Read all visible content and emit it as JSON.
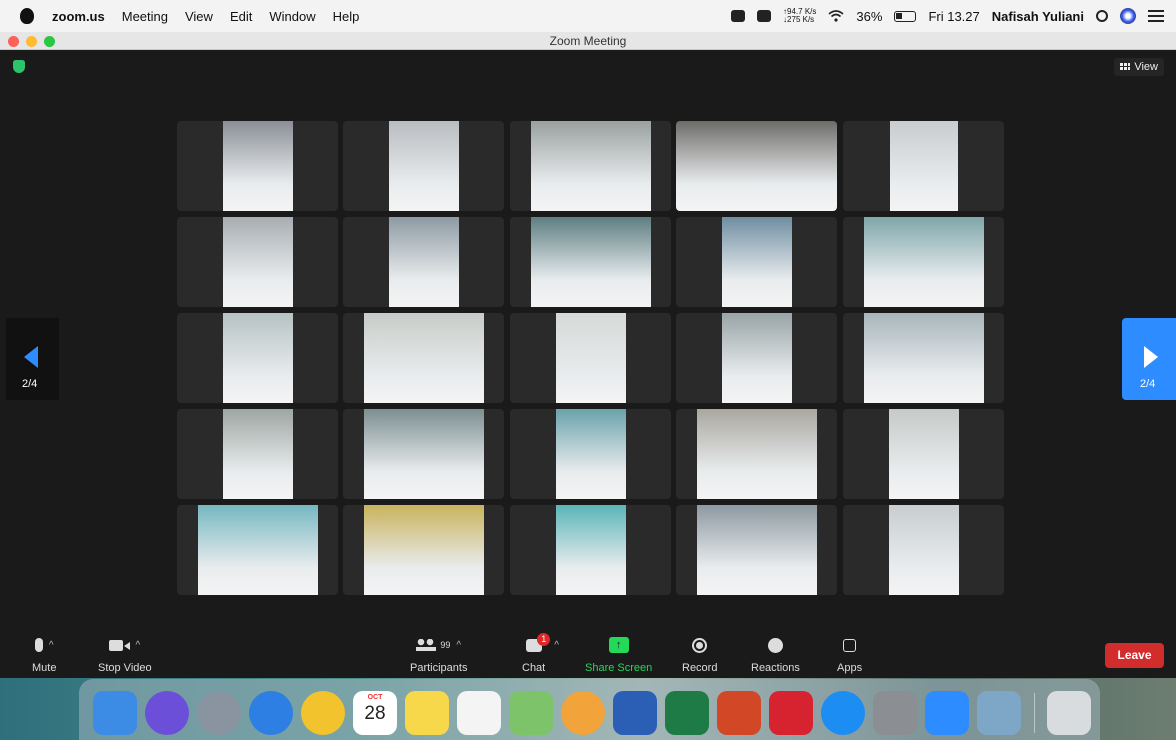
{
  "menubar": {
    "app": "zoom.us",
    "items": [
      "Meeting",
      "View",
      "Edit",
      "Window",
      "Help"
    ],
    "net_up": "↑94.7 K/s",
    "net_down": "↓275 K/s",
    "battery": "36%",
    "clock": "Fri 13.27",
    "user": "Nafisah Yuliani"
  },
  "window": {
    "title": "Zoom Meeting"
  },
  "meeting": {
    "view_label": "View",
    "prev_page": "2/4",
    "next_page": "2/4",
    "tiles": [
      {
        "bg": "#8a8f96"
      },
      {
        "bg": "#b9bcc0"
      },
      {
        "bg": "#9aa0a0"
      },
      {
        "bg": "#6e6c69"
      },
      {
        "bg": "#c9cccf"
      },
      {
        "bg": "#a8adb3"
      },
      {
        "bg": "#8d9aa3"
      },
      {
        "bg": "#5d7e82"
      },
      {
        "bg": "#6f8ea2"
      },
      {
        "bg": "#7fa7aa"
      },
      {
        "bg": "#b6c2c4"
      },
      {
        "bg": "#c8ccc8"
      },
      {
        "bg": "#d5d9d7"
      },
      {
        "bg": "#98a4a6"
      },
      {
        "bg": "#a8b6bb"
      },
      {
        "bg": "#9ea6a2"
      },
      {
        "bg": "#7d8f91"
      },
      {
        "bg": "#6aa3ab"
      },
      {
        "bg": "#a9a7a0"
      },
      {
        "bg": "#c5cac7"
      },
      {
        "bg": "#76b7c1"
      },
      {
        "bg": "#c9b35c"
      },
      {
        "bg": "#5ab5b8"
      },
      {
        "bg": "#8d9aa1"
      },
      {
        "bg": "#c8cdd0"
      }
    ]
  },
  "toolbar": {
    "mute": "Mute",
    "stop_video": "Stop Video",
    "participants": "Participants",
    "participant_count": "99",
    "chat": "Chat",
    "chat_badge": "1",
    "share_screen": "Share Screen",
    "record": "Record",
    "reactions": "Reactions",
    "apps": "Apps",
    "leave": "Leave"
  },
  "dock": {
    "calendar_month": "OCT",
    "calendar_day": "28",
    "apps": [
      {
        "name": "finder-icon",
        "color": "#3c8ce6"
      },
      {
        "name": "siri-icon",
        "color": "#6b4fd8"
      },
      {
        "name": "launchpad-icon",
        "color": "#8a93a0"
      },
      {
        "name": "safari-icon",
        "color": "#2d7fe3"
      },
      {
        "name": "chrome-icon",
        "color": "#f3c32d"
      },
      {
        "name": "calendar-icon",
        "color": "#ffffff"
      },
      {
        "name": "notes-icon",
        "color": "#f7d84a"
      },
      {
        "name": "reminders-icon",
        "color": "#f4f4f4"
      },
      {
        "name": "maps-icon",
        "color": "#7cc36a"
      },
      {
        "name": "photos-icon",
        "color": "#f2a33a"
      },
      {
        "name": "word-icon",
        "color": "#2b5fb6"
      },
      {
        "name": "excel-icon",
        "color": "#1e7b45"
      },
      {
        "name": "powerpoint-icon",
        "color": "#d24726"
      },
      {
        "name": "mendeley-icon",
        "color": "#d6232f"
      },
      {
        "name": "app-store-icon",
        "color": "#1b8df3"
      },
      {
        "name": "system-preferences-icon",
        "color": "#8b8f93"
      },
      {
        "name": "zoom-icon",
        "color": "#2d8cff"
      },
      {
        "name": "preview-icon",
        "color": "#7ea7c7"
      },
      {
        "name": "trash-icon",
        "color": "#d9dcdf"
      }
    ]
  }
}
